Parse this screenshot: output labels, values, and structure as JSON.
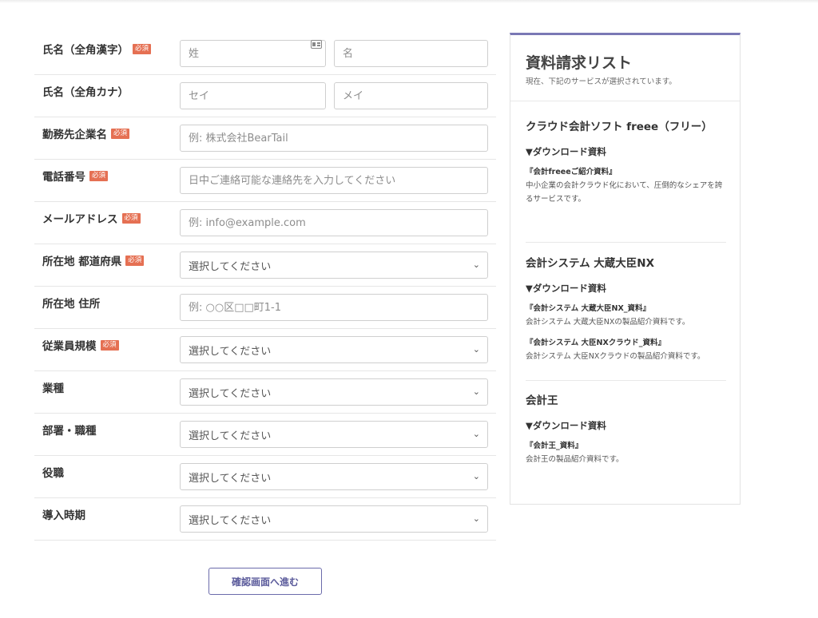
{
  "required_badge": "必須",
  "form": {
    "fields": [
      {
        "label": "氏名（全角漢字）",
        "required": true,
        "type": "split",
        "placeholders": [
          "姓",
          "名"
        ]
      },
      {
        "label": "氏名（全角カナ）",
        "required": false,
        "type": "split",
        "placeholders": [
          "セイ",
          "メイ"
        ]
      },
      {
        "label": "勤務先企業名",
        "required": true,
        "type": "text",
        "placeholder": "例: 株式会社BearTail"
      },
      {
        "label": "電話番号",
        "required": true,
        "type": "text",
        "placeholder": "日中ご連絡可能な連絡先を入力してください"
      },
      {
        "label": "メールアドレス",
        "required": true,
        "type": "text",
        "placeholder": "例: info@example.com"
      },
      {
        "label": "所在地 都道府県",
        "required": true,
        "type": "select",
        "value": "選択してください"
      },
      {
        "label": "所在地 住所",
        "required": false,
        "type": "text",
        "placeholder": "例: ○○区□□町1-1"
      },
      {
        "label": "従業員規模",
        "required": true,
        "type": "select",
        "value": "選択してください"
      },
      {
        "label": "業種",
        "required": false,
        "type": "select",
        "value": "選択してください"
      },
      {
        "label": "部署・職種",
        "required": false,
        "type": "select",
        "value": "選択してください"
      },
      {
        "label": "役職",
        "required": false,
        "type": "select",
        "value": "選択してください"
      },
      {
        "label": "導入時期",
        "required": false,
        "type": "select",
        "value": "選択してください"
      }
    ],
    "submit_label": "確認画面へ進む"
  },
  "panel": {
    "title": "資料請求リスト",
    "subtitle": "現在、下記のサービスが選択されています。",
    "services": [
      {
        "name": "クラウド会計ソフト freee（フリー）",
        "download_heading": "▼ダウンロード資料",
        "docs": [
          {
            "title": "『会計freeeご紹介資料』",
            "desc": "中小企業の会計クラウド化において、圧倒的なシェアを誇るサービスです。"
          }
        ]
      },
      {
        "name": "会計システム 大蔵大臣NX",
        "download_heading": "▼ダウンロード資料",
        "docs": [
          {
            "title": "『会計システム 大蔵大臣NX_資料』",
            "desc": "会計システム 大蔵大臣NXの製品紹介資料です。"
          },
          {
            "title": "『会計システム 大臣NXクラウド_資料』",
            "desc": "会計システム 大臣NXクラウドの製品紹介資料です。"
          }
        ]
      },
      {
        "name": "会計王",
        "download_heading": "▼ダウンロード資料",
        "docs": [
          {
            "title": "『会計王_資料』",
            "desc": "会計王の製品紹介資料です。"
          }
        ]
      }
    ]
  },
  "icons": {
    "contact_card": "contact-card-icon",
    "select_arrow": "chevron-down-icon"
  }
}
